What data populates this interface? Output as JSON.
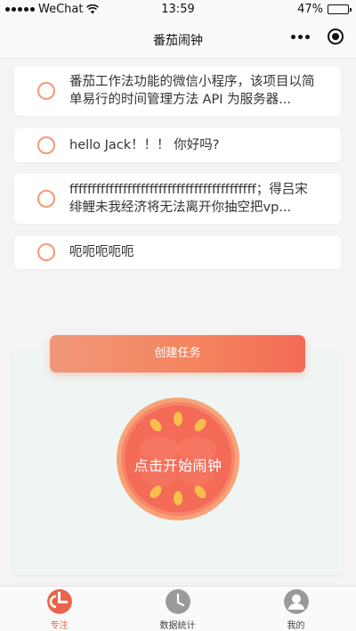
{
  "status_bar": {
    "carrier": "WeChat",
    "time": "13:59",
    "battery": "47%",
    "battery_level": 0.47
  },
  "navbar": {
    "title": "番茄闹钟",
    "more_icon": "more-dots-icon",
    "close_icon": "target-icon"
  },
  "tasks": [
    {
      "text": "番茄工作法功能的微信小程序，该项目以简单易行的时间管理方法 API 为服务器..."
    },
    {
      "text": "hello Jack！！！ 你好吗?"
    },
    {
      "text": "ffffffffffffffffffffffffffffffffffffffffff；得吕宋绯鲤未我经济将无法离开你抽空把vp..."
    },
    {
      "text": "呃呃呃呃呃"
    }
  ],
  "create_button": {
    "label": "创建任务"
  },
  "tomato": {
    "label": "点击开始闹钟",
    "colors": {
      "outer": "#f7a377",
      "inner": "#f46b58",
      "seed": "#f6c04a"
    }
  },
  "tabbar": {
    "items": [
      {
        "label": "专注",
        "icon": "tomato-icon",
        "active": true
      },
      {
        "label": "数据统计",
        "icon": "clock-icon",
        "active": false
      },
      {
        "label": "我的",
        "icon": "user-icon",
        "active": false
      }
    ],
    "active_color": "#e8664d"
  }
}
